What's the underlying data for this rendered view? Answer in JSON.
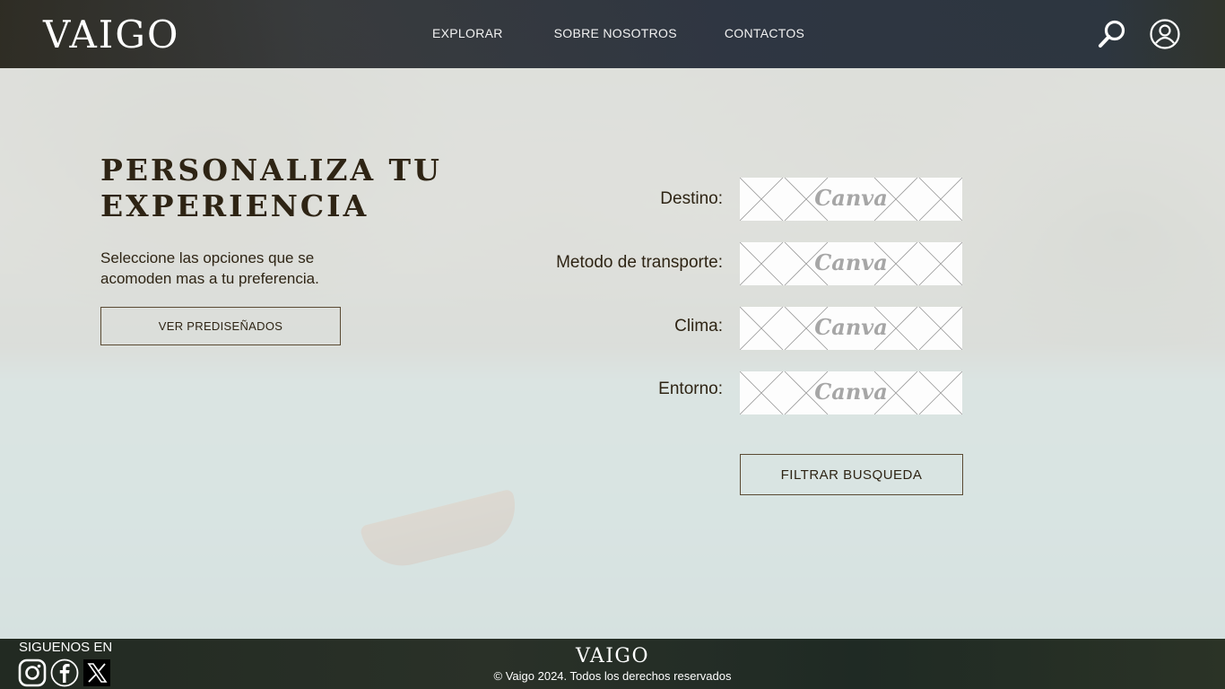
{
  "header": {
    "logo": "VAIGO",
    "nav": [
      "EXPLORAR",
      "SOBRE NOSOTROS",
      "CONTACTOS"
    ],
    "icons": [
      "search-icon",
      "user-icon"
    ]
  },
  "intro": {
    "title": "PERSONALIZA TU\nEXPERIENCIA",
    "subtitle": "Seleccione las opciones que se acomoden mas a tu preferencia.",
    "button": "VER PREDISEÑADOS"
  },
  "form": {
    "fields": [
      {
        "label": "Destino:",
        "placeholder": "Canva"
      },
      {
        "label": "Metodo de transporte:",
        "placeholder": "Canva"
      },
      {
        "label": "Clima:",
        "placeholder": "Canva"
      },
      {
        "label": "Entorno:",
        "placeholder": "Canva"
      }
    ],
    "submit": "FILTRAR BUSQUEDA"
  },
  "footer": {
    "follow": "SIGUENOS EN",
    "social": [
      "instagram-icon",
      "facebook-icon",
      "x-icon"
    ],
    "logo": "VAIGO",
    "copyright": "© Vaigo 2024. Todos los derechos reservados"
  },
  "colors": {
    "text": "#2e2414",
    "button_border": "#5a4a33",
    "header_bg": "#2f3a48",
    "footer_bg": "#252d25"
  }
}
